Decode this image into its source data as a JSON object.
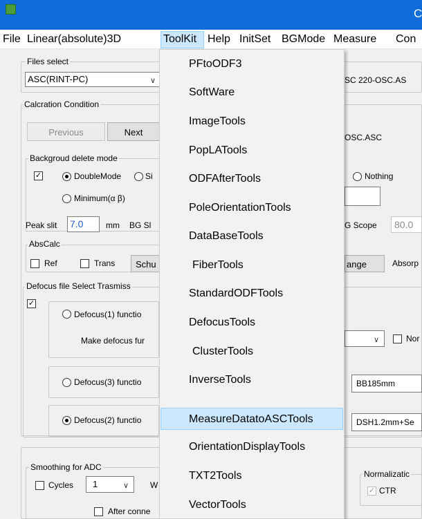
{
  "title_bar": {
    "title_fragment": "C",
    "icon": "app-icon"
  },
  "menubar": {
    "items": [
      "File",
      "Linear(absolute)3D",
      "ToolKit",
      "Help",
      "InitSet",
      "BGMode",
      "Measure",
      "Con"
    ]
  },
  "toolkit_menu": {
    "items": [
      "PFtoODF3",
      "SoftWare",
      "ImageTools",
      "PopLATools",
      "ODFAfterTools",
      "PoleOrientationTools",
      "DataBaseTools",
      "FiberTools",
      "StandardODFTools",
      "DefocusTools",
      "ClusterTools",
      "InverseTools",
      "MeasureDatatoASCTools",
      "OrientationDisplayTools",
      "TXT2Tools",
      "VectorTools"
    ],
    "highlighted": "MeasureDatatoASCTools"
  },
  "files_select": {
    "legend": "Files select",
    "selected": "ASC(RINT-PC)",
    "right_text": "SC 220-OSC.AS"
  },
  "calc_condition": {
    "legend": "Calcration Condition",
    "previous_label": "Previous",
    "next_label": "Next",
    "right_text": "OSC.ASC"
  },
  "background_mode": {
    "legend": "Backgroud delete mode",
    "checked": true,
    "double_mode_label": "DoubleMode",
    "single_fragment": "Si",
    "minimum_label": "Minimum(α β)",
    "nothing_label": "Nothing",
    "peak_slit_label": "Peak slit",
    "peak_slit_value": "7.0",
    "mm_label": "mm",
    "bg_sl_label": "BG Sl",
    "bg_scope_label": "G Scope",
    "bg_scope_value": "80.0"
  },
  "abs_calc": {
    "legend": "AbsCalc",
    "ref_label": "Ref",
    "trans_label": "Trans",
    "schu_label": "Schu",
    "change_label": "ange",
    "absorp_label": "Absorp"
  },
  "defocus": {
    "legend": "Defocus file Select Trasmiss",
    "checked": true,
    "func1_label": "Defocus(1) functio",
    "make_label": "Make defocus fur",
    "nor_label": "Nor",
    "func3_label": "Defocus(3) functio",
    "func3_value": "BB185mm",
    "func2_label": "Defocus(2) functio",
    "func2_value": "DSH1.2mm+Se"
  },
  "smoothing": {
    "legend": "Smoothing for ADC",
    "cycles_label": "Cycles",
    "cycles_value": "1",
    "w_label": "W",
    "after_label": "After conne",
    "normalization_legend": "Normalizatic",
    "ctr_label": "CTR",
    "ctr_checked": true
  }
}
